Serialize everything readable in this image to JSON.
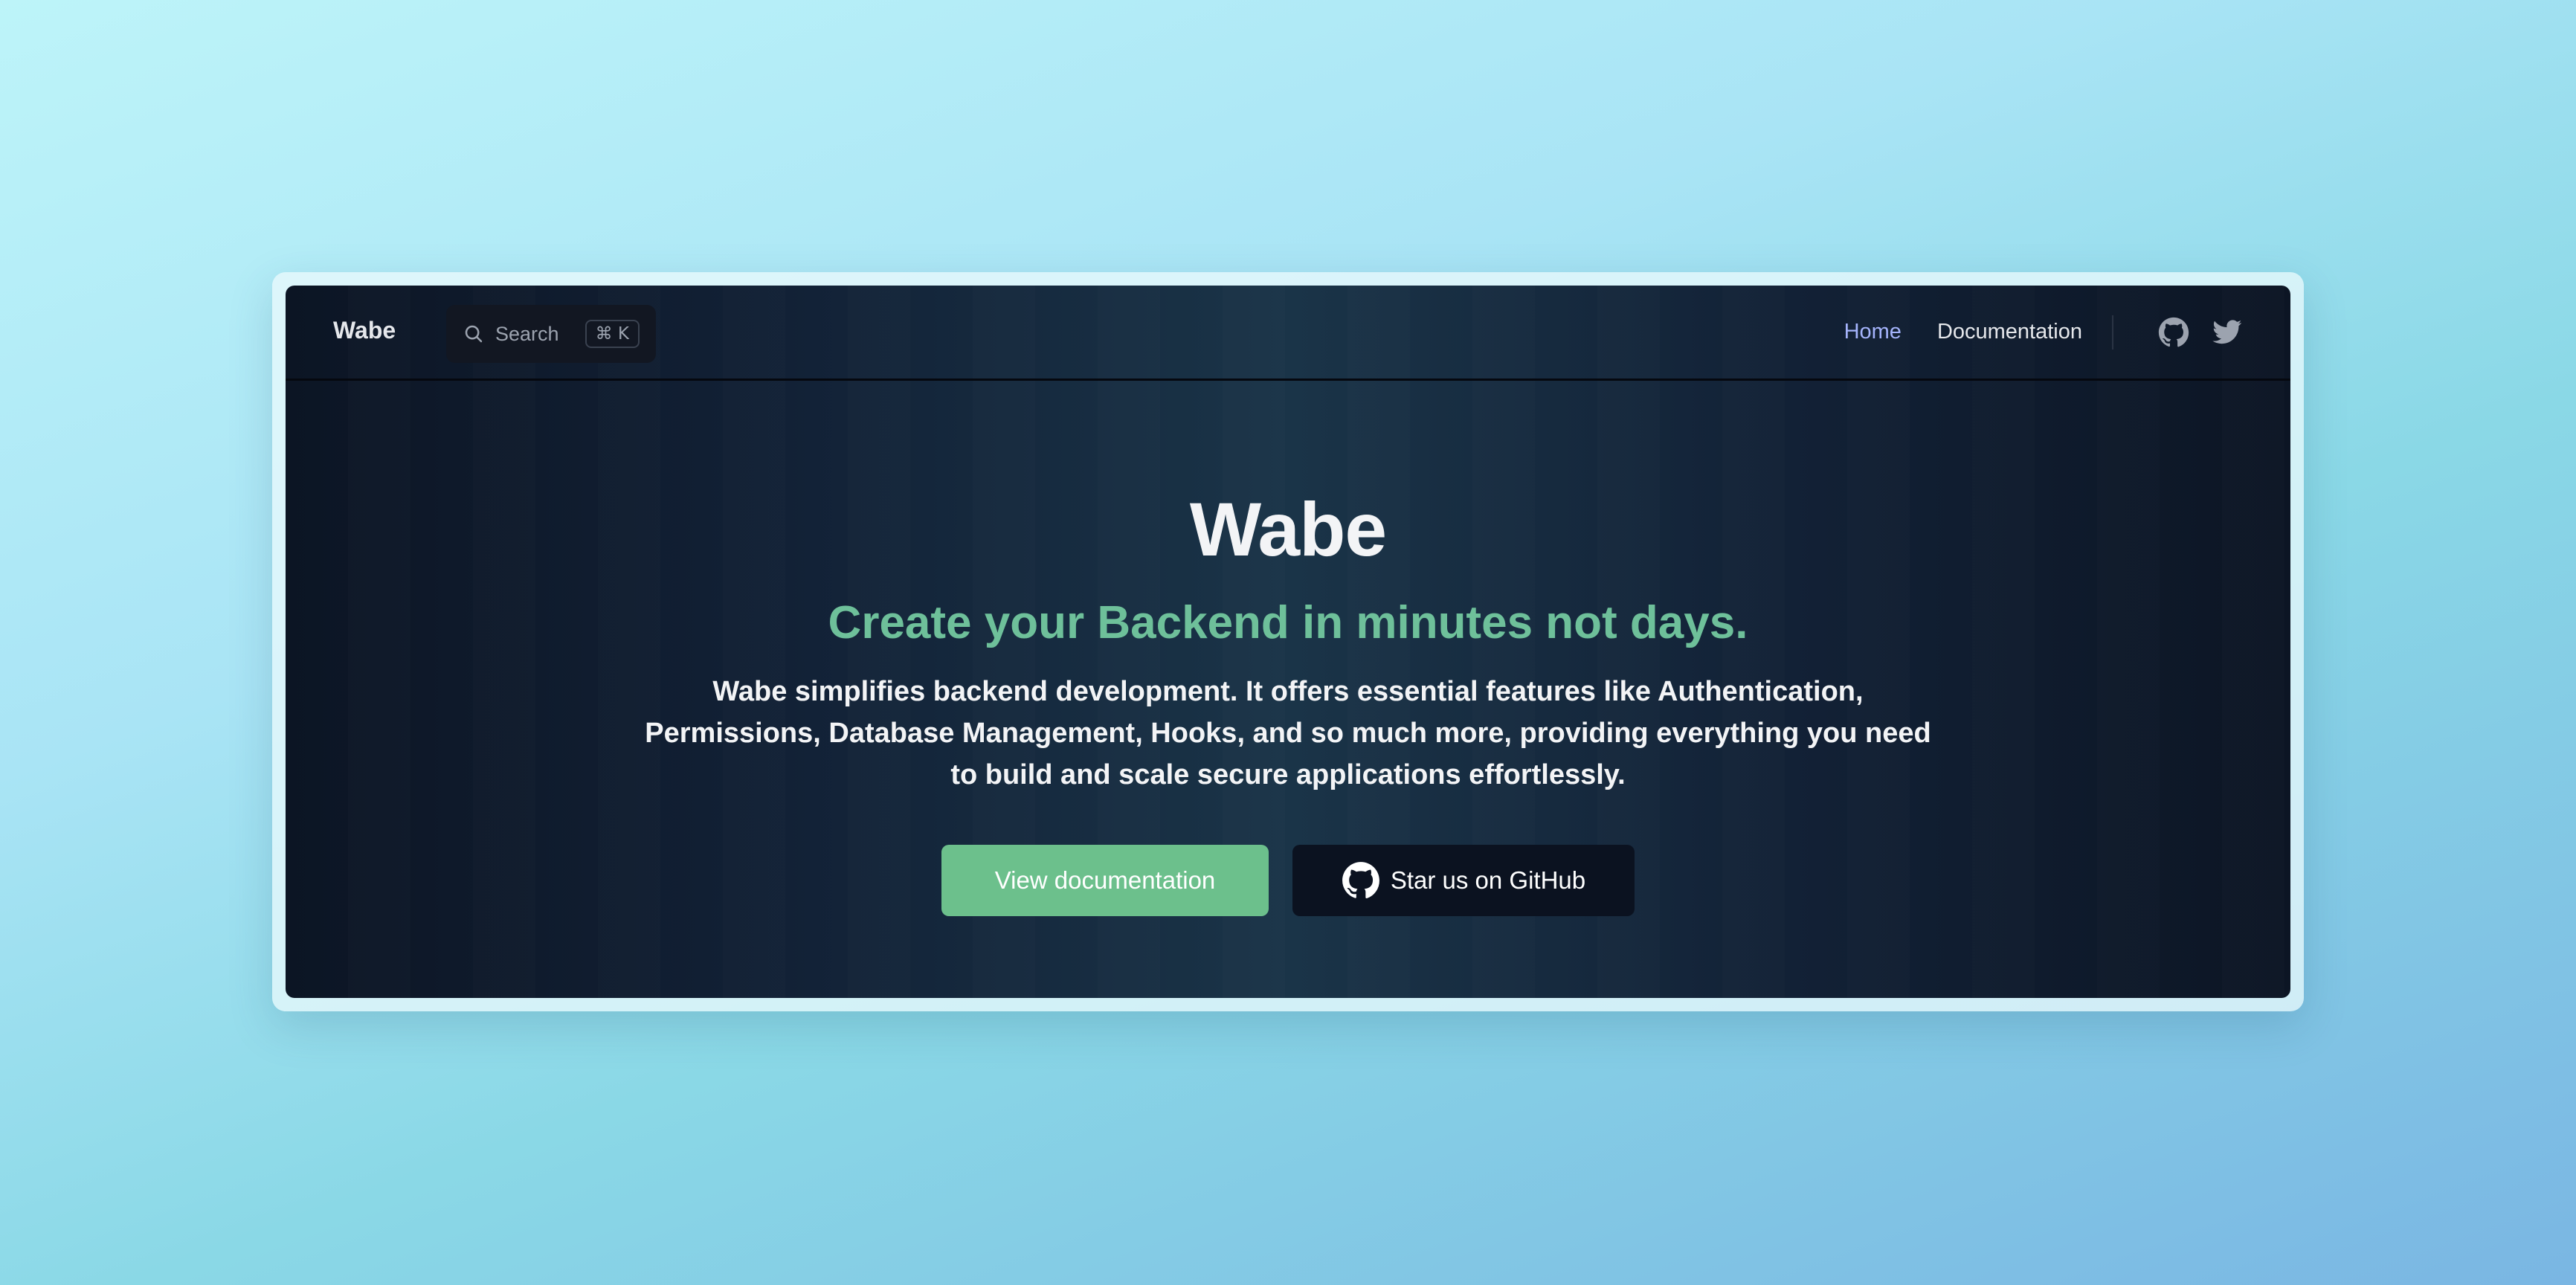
{
  "navbar": {
    "brand": "Wabe",
    "search": {
      "placeholder": "Search",
      "shortcut": "⌘ K",
      "icon": "search-icon"
    },
    "links": [
      {
        "label": "Home",
        "active": true
      },
      {
        "label": "Documentation",
        "active": false
      }
    ],
    "social_icons": [
      "github-icon",
      "twitter-icon"
    ]
  },
  "hero": {
    "title": "Wabe",
    "tagline": "Create your Backend in minutes not days.",
    "description": "Wabe simplifies backend development. It offers essential features like Authentication, Permissions, Database Management, Hooks, and so much more, providing everything you need to build and scale secure applications effortlessly.",
    "primary_button": "View documentation",
    "secondary_button": "Star us on GitHub",
    "secondary_button_icon": "github-icon"
  },
  "colors": {
    "accent_green": "#6ec09a",
    "button_green": "#6cc08c",
    "active_link": "#a5b4fc",
    "background_dark": "#122136"
  }
}
